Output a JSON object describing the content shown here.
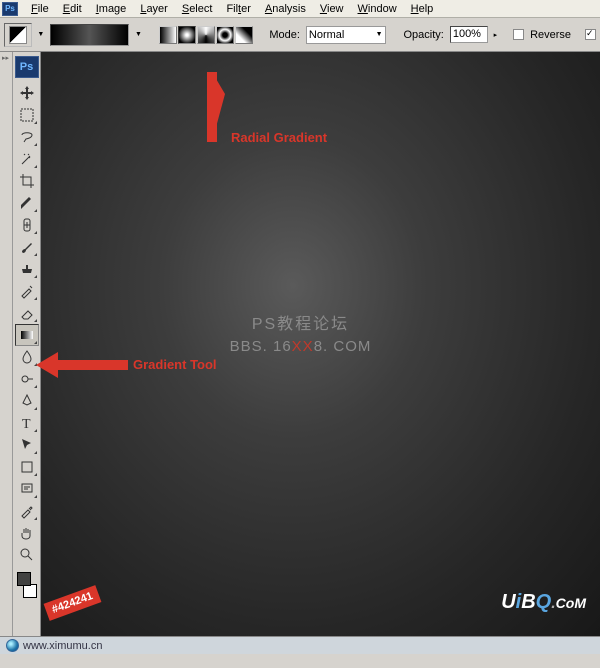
{
  "menubar": {
    "items": [
      "File",
      "Edit",
      "Image",
      "Layer",
      "Select",
      "Filter",
      "Analysis",
      "View",
      "Window",
      "Help"
    ]
  },
  "optbar": {
    "mode_label": "Mode:",
    "mode_value": "Normal",
    "opacity_label": "Opacity:",
    "opacity_value": "100%",
    "reverse_label": "Reverse"
  },
  "annotations": {
    "radial": "Radial Gradient",
    "gradient_tool": "Gradient Tool",
    "swatch_hex": "#424241"
  },
  "watermark": {
    "line1": "PS教程论坛",
    "line2_pre": "BBS. 16",
    "line2_mid": "XX",
    "line2_post": "8. COM"
  },
  "brand": {
    "text": "UiBQ.CoM"
  },
  "footer": {
    "url": "www.ximumu.cn"
  },
  "ps_label": "Ps",
  "app_icon_label": "Ps"
}
